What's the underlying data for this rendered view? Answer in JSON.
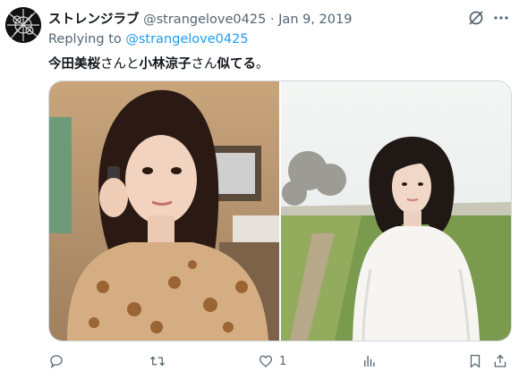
{
  "tweet": {
    "display_name": "ストレンジラブ",
    "handle": "@strangelove0425",
    "separator": "·",
    "date": "Jan 9, 2019",
    "replying_label": "Replying to",
    "replying_handle": "@strangelove0425",
    "text": {
      "name1": "今田美桜",
      "part1": "さんと",
      "name2": "小林涼子",
      "part2": "さん",
      "ending": "似てる",
      "period": "。"
    }
  },
  "actions": {
    "reply_count": "",
    "retweet_count": "",
    "like_count": "1",
    "views_count": ""
  },
  "icons": {
    "grok": "grok-icon",
    "more": "more-dots-icon",
    "reply": "reply-bubble-icon",
    "retweet": "retweet-icon",
    "like": "heart-icon",
    "views": "bar-chart-icon",
    "bookmark": "bookmark-icon",
    "share": "share-upload-icon"
  },
  "colors": {
    "link": "#1d9bf0",
    "muted": "#536471",
    "border": "#cfd9de"
  }
}
